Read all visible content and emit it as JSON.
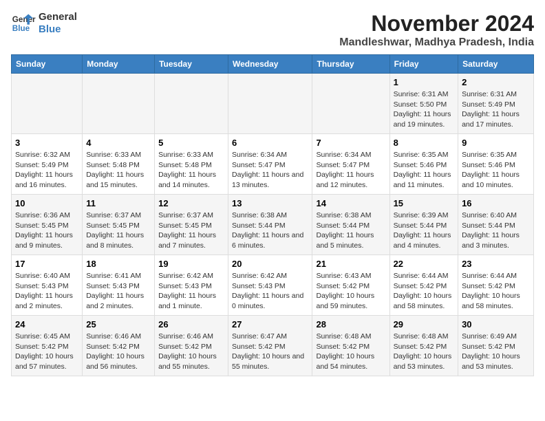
{
  "logo": {
    "line1": "General",
    "line2": "Blue"
  },
  "title": "November 2024",
  "subtitle": "Mandleshwar, Madhya Pradesh, India",
  "days_of_week": [
    "Sunday",
    "Monday",
    "Tuesday",
    "Wednesday",
    "Thursday",
    "Friday",
    "Saturday"
  ],
  "weeks": [
    [
      {
        "day": "",
        "info": ""
      },
      {
        "day": "",
        "info": ""
      },
      {
        "day": "",
        "info": ""
      },
      {
        "day": "",
        "info": ""
      },
      {
        "day": "",
        "info": ""
      },
      {
        "day": "1",
        "info": "Sunrise: 6:31 AM\nSunset: 5:50 PM\nDaylight: 11 hours and 19 minutes."
      },
      {
        "day": "2",
        "info": "Sunrise: 6:31 AM\nSunset: 5:49 PM\nDaylight: 11 hours and 17 minutes."
      }
    ],
    [
      {
        "day": "3",
        "info": "Sunrise: 6:32 AM\nSunset: 5:49 PM\nDaylight: 11 hours and 16 minutes."
      },
      {
        "day": "4",
        "info": "Sunrise: 6:33 AM\nSunset: 5:48 PM\nDaylight: 11 hours and 15 minutes."
      },
      {
        "day": "5",
        "info": "Sunrise: 6:33 AM\nSunset: 5:48 PM\nDaylight: 11 hours and 14 minutes."
      },
      {
        "day": "6",
        "info": "Sunrise: 6:34 AM\nSunset: 5:47 PM\nDaylight: 11 hours and 13 minutes."
      },
      {
        "day": "7",
        "info": "Sunrise: 6:34 AM\nSunset: 5:47 PM\nDaylight: 11 hours and 12 minutes."
      },
      {
        "day": "8",
        "info": "Sunrise: 6:35 AM\nSunset: 5:46 PM\nDaylight: 11 hours and 11 minutes."
      },
      {
        "day": "9",
        "info": "Sunrise: 6:35 AM\nSunset: 5:46 PM\nDaylight: 11 hours and 10 minutes."
      }
    ],
    [
      {
        "day": "10",
        "info": "Sunrise: 6:36 AM\nSunset: 5:45 PM\nDaylight: 11 hours and 9 minutes."
      },
      {
        "day": "11",
        "info": "Sunrise: 6:37 AM\nSunset: 5:45 PM\nDaylight: 11 hours and 8 minutes."
      },
      {
        "day": "12",
        "info": "Sunrise: 6:37 AM\nSunset: 5:45 PM\nDaylight: 11 hours and 7 minutes."
      },
      {
        "day": "13",
        "info": "Sunrise: 6:38 AM\nSunset: 5:44 PM\nDaylight: 11 hours and 6 minutes."
      },
      {
        "day": "14",
        "info": "Sunrise: 6:38 AM\nSunset: 5:44 PM\nDaylight: 11 hours and 5 minutes."
      },
      {
        "day": "15",
        "info": "Sunrise: 6:39 AM\nSunset: 5:44 PM\nDaylight: 11 hours and 4 minutes."
      },
      {
        "day": "16",
        "info": "Sunrise: 6:40 AM\nSunset: 5:44 PM\nDaylight: 11 hours and 3 minutes."
      }
    ],
    [
      {
        "day": "17",
        "info": "Sunrise: 6:40 AM\nSunset: 5:43 PM\nDaylight: 11 hours and 2 minutes."
      },
      {
        "day": "18",
        "info": "Sunrise: 6:41 AM\nSunset: 5:43 PM\nDaylight: 11 hours and 2 minutes."
      },
      {
        "day": "19",
        "info": "Sunrise: 6:42 AM\nSunset: 5:43 PM\nDaylight: 11 hours and 1 minute."
      },
      {
        "day": "20",
        "info": "Sunrise: 6:42 AM\nSunset: 5:43 PM\nDaylight: 11 hours and 0 minutes."
      },
      {
        "day": "21",
        "info": "Sunrise: 6:43 AM\nSunset: 5:42 PM\nDaylight: 10 hours and 59 minutes."
      },
      {
        "day": "22",
        "info": "Sunrise: 6:44 AM\nSunset: 5:42 PM\nDaylight: 10 hours and 58 minutes."
      },
      {
        "day": "23",
        "info": "Sunrise: 6:44 AM\nSunset: 5:42 PM\nDaylight: 10 hours and 58 minutes."
      }
    ],
    [
      {
        "day": "24",
        "info": "Sunrise: 6:45 AM\nSunset: 5:42 PM\nDaylight: 10 hours and 57 minutes."
      },
      {
        "day": "25",
        "info": "Sunrise: 6:46 AM\nSunset: 5:42 PM\nDaylight: 10 hours and 56 minutes."
      },
      {
        "day": "26",
        "info": "Sunrise: 6:46 AM\nSunset: 5:42 PM\nDaylight: 10 hours and 55 minutes."
      },
      {
        "day": "27",
        "info": "Sunrise: 6:47 AM\nSunset: 5:42 PM\nDaylight: 10 hours and 55 minutes."
      },
      {
        "day": "28",
        "info": "Sunrise: 6:48 AM\nSunset: 5:42 PM\nDaylight: 10 hours and 54 minutes."
      },
      {
        "day": "29",
        "info": "Sunrise: 6:48 AM\nSunset: 5:42 PM\nDaylight: 10 hours and 53 minutes."
      },
      {
        "day": "30",
        "info": "Sunrise: 6:49 AM\nSunset: 5:42 PM\nDaylight: 10 hours and 53 minutes."
      }
    ]
  ]
}
